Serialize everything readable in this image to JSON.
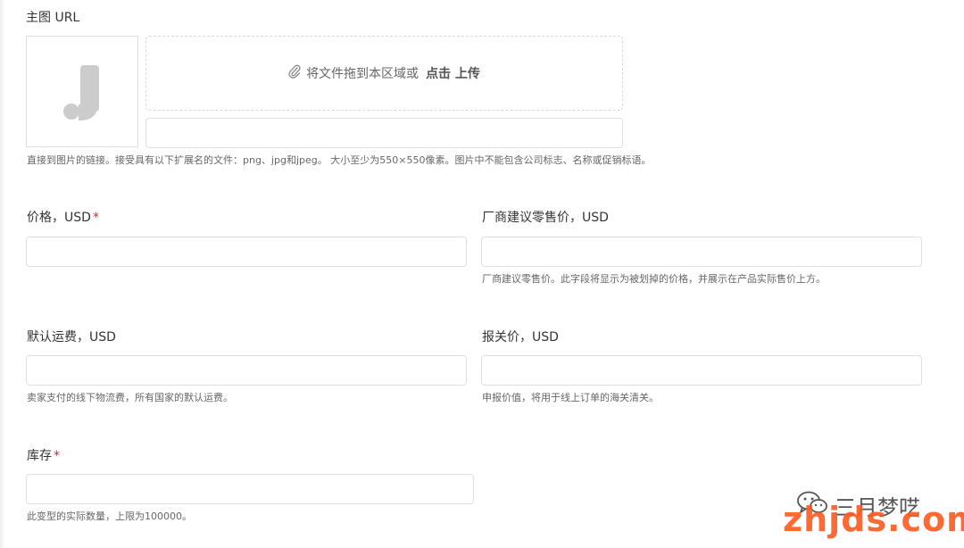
{
  "main_image": {
    "label": "主图 URL",
    "dropzone_text": "将文件拖到本区域或",
    "dropzone_action": "点击 上传",
    "url_value": "",
    "help": "直接到图片的链接。接受具有以下扩展名的文件：png、jpg和jpeg。 大小至少为550×550像素。图片中不能包含公司标志、名称或促销标语。",
    "preview_icon": "placeholder-j-logo-icon",
    "clip_icon": "paperclip-icon"
  },
  "price": {
    "label": "价格，USD",
    "required_mark": "*",
    "value": ""
  },
  "msrp": {
    "label": "厂商建议零售价，USD",
    "value": "",
    "help": "厂商建议零售价。此字段将显示为被划掉的价格，并展示在产品实际售价上方。"
  },
  "shipping": {
    "label": "默认运费，USD",
    "value": "",
    "help": "卖家支付的线下物流费，所有国家的默认运费。"
  },
  "customs": {
    "label": "报关价，USD",
    "value": "",
    "help": "申报价值，将用于线上订单的海关清关。"
  },
  "inventory": {
    "label": "库存",
    "required_mark": "*",
    "value": "",
    "help": "此变型的实际数量，上限为100000。"
  },
  "watermark": {
    "wechat_name": "三月梦呓",
    "site": "zhjds.com",
    "wechat_icon": "wechat-icon"
  },
  "colors": {
    "required": "#e02020",
    "border": "#dcdfe6",
    "watermark": "#ff5a1f"
  }
}
